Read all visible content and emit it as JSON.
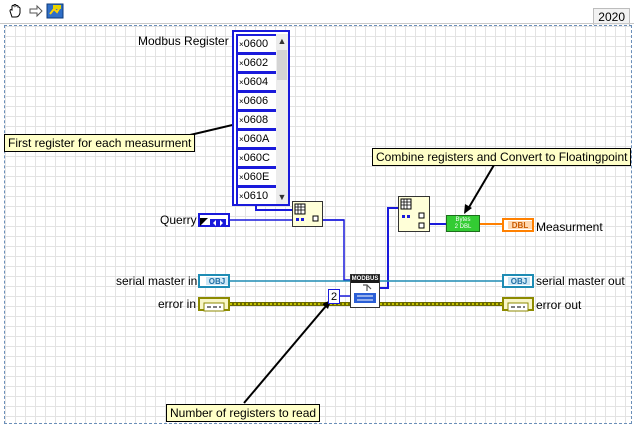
{
  "toolbar": {
    "run_hand_icon": "hand-icon",
    "step_icon": "arrow-icon",
    "highlight_icon": "highlight-icon",
    "version": "2020"
  },
  "diagram": {
    "array_label": "Modbus Register",
    "array_prefix": "×",
    "array_items": [
      "0600",
      "0602",
      "0604",
      "0606",
      "0608",
      "060A",
      "060C",
      "060E",
      "0610"
    ],
    "querry_label": "Querry",
    "serial_master_in": "serial master in",
    "error_in": "error in",
    "measurement_label": "Measurment",
    "serial_master_out": "serial master out",
    "error_out": "error out",
    "constant_value": "2",
    "modbus_label": "MODBUS",
    "bytes_to_dbl_line1": "Bytes",
    "bytes_to_dbl_line2": "2 DBL",
    "dbl_tag": "DBL",
    "obj_tag": "OBJ"
  },
  "notes": {
    "first_register": "First register for each measurment",
    "combine": "Combine registers and Convert to Floatingpoint",
    "num_registers": "Number of registers to read"
  },
  "colors": {
    "wire_blue": "#1a1adb",
    "wire_cluster": "#8c8a00",
    "refnum_wire": "#1e8cb4",
    "note_bg": "#ffffc8",
    "dbl_orange": "#ff8000",
    "function_green": "#33cc33"
  }
}
